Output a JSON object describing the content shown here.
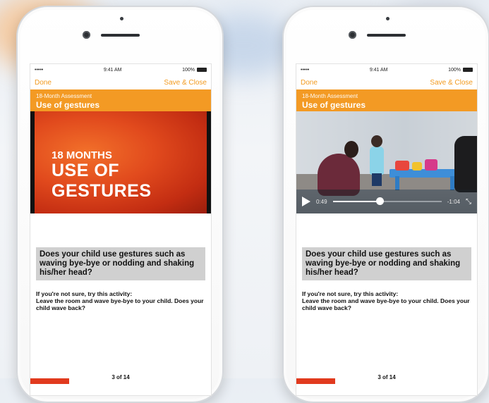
{
  "colors": {
    "accent": "#f39a24",
    "banner": "#e14a1d",
    "progress": "#e13a1e"
  },
  "phones": [
    {
      "status": {
        "signal": "•••••",
        "time": "9:41 AM",
        "battery": "100%"
      },
      "nav": {
        "left": "Done",
        "right": "Save & Close"
      },
      "header": {
        "subtitle": "18-Month Assessment",
        "title": "Use of gestures"
      },
      "banner": {
        "line1": "18 MONTHS",
        "line2": "USE OF GESTURES"
      },
      "question": "Does your child use gestures such as waving bye-bye or nodding and shaking his/her head?",
      "hint": {
        "title": "If you're not sure, try this activity:",
        "body": "Leave the room and wave bye-bye to your child. Does your child wave back?"
      },
      "progress": {
        "label": "3 of 14",
        "fraction": 0.214
      }
    },
    {
      "status": {
        "signal": "•••••",
        "time": "9:41 AM",
        "battery": "100%"
      },
      "nav": {
        "left": "Done",
        "right": "Save & Close"
      },
      "header": {
        "subtitle": "18-Month Assessment",
        "title": "Use of gestures"
      },
      "video": {
        "elapsed": "0:49",
        "remaining": "-1:04",
        "position": 0.43
      },
      "question": "Does your child use gestures such as waving bye-bye or nodding and shaking his/her head?",
      "hint": {
        "title": "If you're not sure, try this activity:",
        "body": "Leave the room and wave bye-bye to your child. Does your child wave back?"
      },
      "progress": {
        "label": "3 of 14",
        "fraction": 0.214
      }
    }
  ]
}
